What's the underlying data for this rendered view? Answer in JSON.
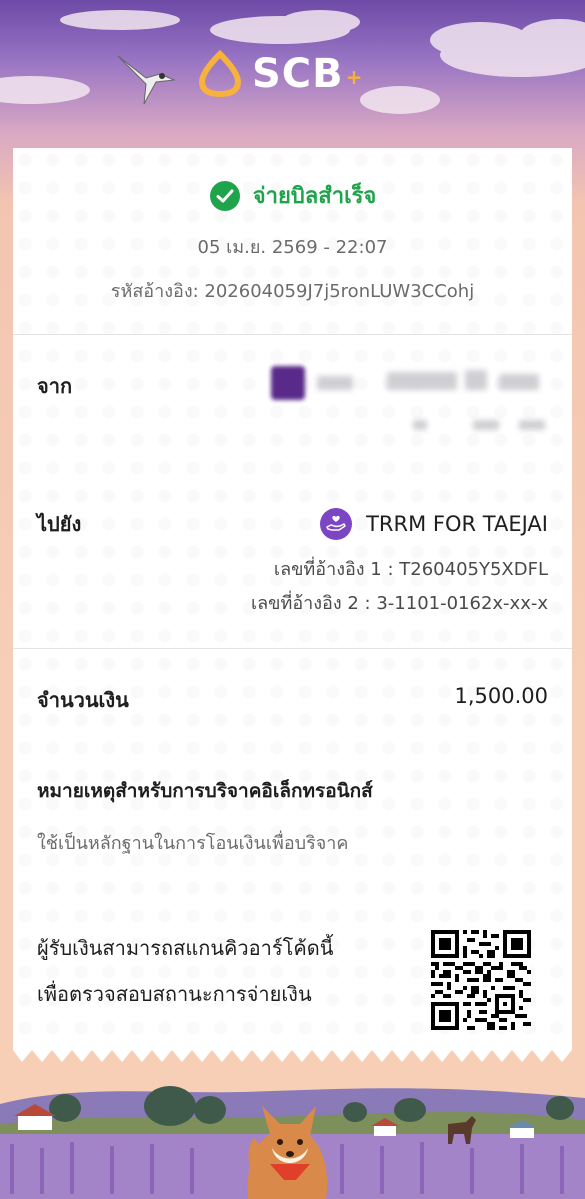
{
  "brand": {
    "name": "SCB",
    "plus": "+"
  },
  "status": {
    "text": "จ่ายบิลสำเร็จ"
  },
  "datetime": "05 เม.ย. 2569 - 22:07",
  "reference": "รหัสอ้างอิง: 202604059J7j5ronLUW3CCohj",
  "from": {
    "label": "จาก"
  },
  "to": {
    "label": "ไปยัง",
    "payee_name": "TRRM FOR TAEJAI",
    "ref1": "เลขที่อ้างอิง 1 : T260405Y5XDFL",
    "ref2": "เลขที่อ้างอิง 2 : 3-1101-0162x-xx-x"
  },
  "amount": {
    "label": "จำนวนเงิน",
    "value": "1,500.00"
  },
  "note": {
    "title": "หมายเหตุสำหรับการบริจาคอิเล็กทรอนิกส์",
    "text": "ใช้เป็นหลักฐานในการโอนเงินเพื่อบริจาค"
  },
  "qr": {
    "line1": "ผู้รับเงินสามารถสแกนคิวอาร์โค้ดนี้",
    "line2": "เพื่อตรวจสอบสถานะการจ่ายเงิน"
  },
  "colors": {
    "success": "#1fa44b",
    "brand_purple": "#5a2a8a",
    "brand_gold": "#f6b23c",
    "payee_icon": "#7b45c4"
  }
}
